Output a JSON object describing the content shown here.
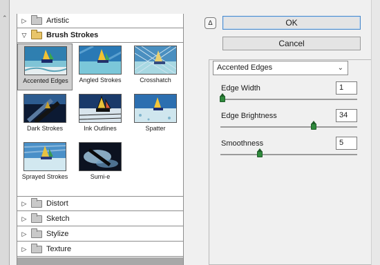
{
  "filter_gallery": {
    "categories_top": [
      {
        "label": "Artistic",
        "expanded": false
      },
      {
        "label": "Brush Strokes",
        "expanded": true
      }
    ],
    "thumbnails": [
      {
        "caption": "Accented Edges",
        "selected": true
      },
      {
        "caption": "Angled Strokes",
        "selected": false
      },
      {
        "caption": "Crosshatch",
        "selected": false
      },
      {
        "caption": "Dark Strokes",
        "selected": false
      },
      {
        "caption": "Ink Outlines",
        "selected": false
      },
      {
        "caption": "Spatter",
        "selected": false
      },
      {
        "caption": "Sprayed Strokes",
        "selected": false
      },
      {
        "caption": "Sumi-e",
        "selected": false
      }
    ],
    "categories_bottom": [
      {
        "label": "Distort",
        "expanded": false
      },
      {
        "label": "Sketch",
        "expanded": false
      },
      {
        "label": "Stylize",
        "expanded": false
      },
      {
        "label": "Texture",
        "expanded": false
      }
    ]
  },
  "buttons": {
    "ok": "OK",
    "cancel": "Cancel"
  },
  "filter_select": {
    "value": "Accented Edges"
  },
  "params": [
    {
      "label": "Edge Width",
      "value": "1",
      "slider_fraction": 0.0
    },
    {
      "label": "Edge Brightness",
      "value": "34",
      "slider_fraction": 0.68
    },
    {
      "label": "Smoothness",
      "value": "5",
      "slider_fraction": 0.29
    }
  ],
  "icons": {
    "collapse": "collapse-up-icon",
    "expand_arrow": "triangle-right-icon",
    "collapse_arrow": "triangle-down-icon",
    "folder": "folder-icon",
    "dropdown": "chevron-down-icon"
  },
  "colors": {
    "default_button_border": "#4a88c9",
    "slider_thumb": "#2f8a3c",
    "folder_open": "#e8c56a"
  }
}
